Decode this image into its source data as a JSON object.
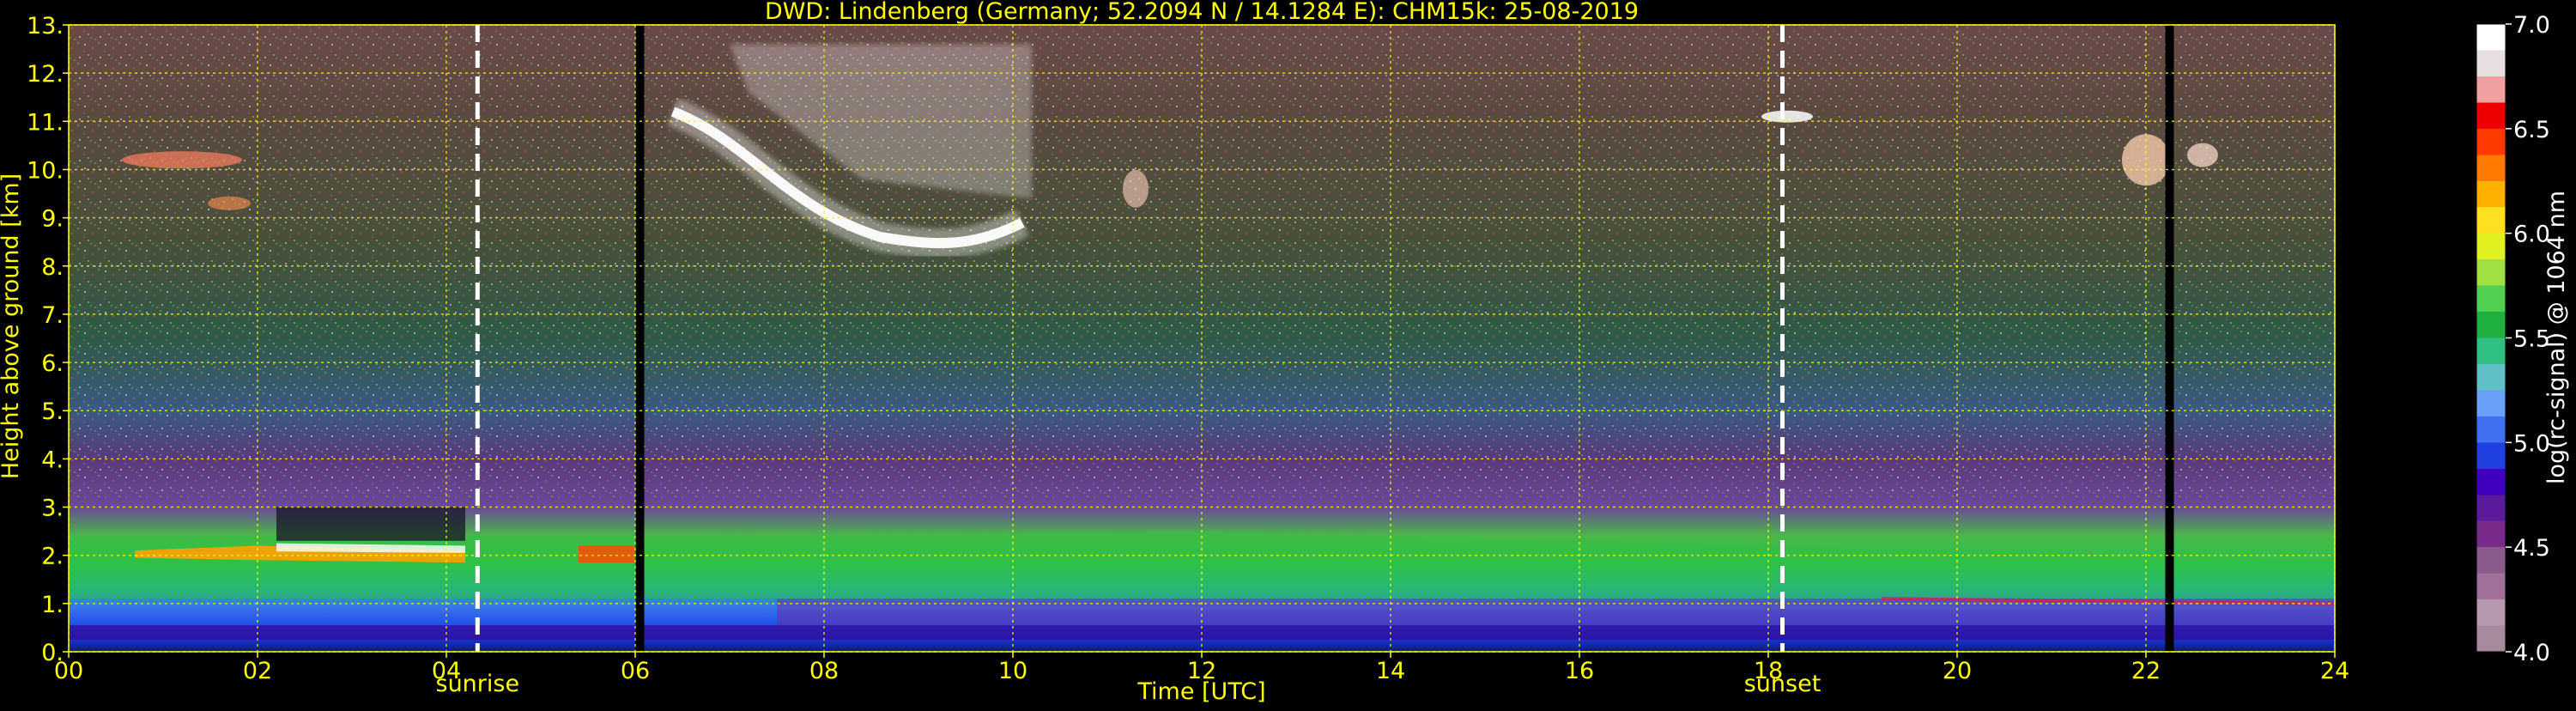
{
  "chart_data": {
    "type": "heatmap",
    "title": "DWD: Lindenberg (Germany; 52.2094 N / 14.1284 E):    CHM15k: 25-08-2019",
    "xlabel": "Time [UTC]",
    "ylabel": "Height above ground [km]",
    "xlim": [
      0,
      24
    ],
    "ylim": [
      0,
      13
    ],
    "x_ticks": [
      0,
      2,
      4,
      6,
      8,
      10,
      12,
      14,
      16,
      18,
      20,
      22,
      24
    ],
    "x_tick_labels": [
      "00",
      "02",
      "04",
      "06",
      "08",
      "10",
      "12",
      "14",
      "16",
      "18",
      "20",
      "22",
      "24"
    ],
    "y_ticks": [
      0,
      1,
      2,
      3,
      4,
      5,
      6,
      7,
      8,
      9,
      10,
      11,
      12,
      13
    ],
    "y_tick_labels": [
      "0.",
      "1.",
      "1.",
      "2.",
      "3.",
      "4.",
      "5.",
      "6.",
      "7.",
      "8.",
      "9.",
      "10.",
      "11.",
      "12.",
      "13."
    ],
    "y_tick_labels_shown": [
      "0.",
      "1.",
      "2.",
      "3.",
      "4.",
      "5.",
      "6.",
      "7.",
      "8.",
      "9.",
      "10.",
      "11.",
      "12.",
      "13."
    ],
    "grid": true,
    "grid_color": "#ffff00",
    "annotations": [
      {
        "label": "sunrise",
        "x": 4.33,
        "style": "dashed",
        "color": "#ffffff"
      },
      {
        "label": "sunset",
        "x": 18.15,
        "style": "dashed",
        "color": "#ffffff"
      }
    ],
    "data_gaps": [
      6.05,
      22.25
    ],
    "features": [
      {
        "name": "boundary-layer-aerosol",
        "x_range": [
          0,
          24
        ],
        "height_range": [
          0.2,
          2.5
        ]
      },
      {
        "name": "cirrus",
        "x_range": [
          6.4,
          10.2
        ],
        "height_range": [
          8.0,
          11.3
        ]
      },
      {
        "name": "cirrus",
        "x_range": [
          0,
          2.1
        ],
        "height_range": [
          9.2,
          10.5
        ]
      },
      {
        "name": "cirrus",
        "x_range": [
          17.7,
          18.6
        ],
        "height_range": [
          11.0,
          11.3
        ]
      },
      {
        "name": "cirrus",
        "x_range": [
          21.5,
          22.8
        ],
        "height_range": [
          9.6,
          10.8
        ]
      }
    ],
    "colorbar": {
      "label": "log(rc-signal) @ 1064 nm",
      "min": 4.0,
      "max": 7.0,
      "ticks": [
        4.0,
        4.5,
        5.0,
        5.5,
        6.0,
        6.5,
        7.0
      ],
      "tick_labels": [
        "4.0",
        "4.5",
        "5.0",
        "5.5",
        "6.0",
        "6.5",
        "7.0"
      ],
      "colors": [
        "#a68b9e",
        "#b699ae",
        "#a07098",
        "#8a5a8c",
        "#7a2a8a",
        "#5a1a9a",
        "#4000c0",
        "#2040e0",
        "#4070f0",
        "#6aa0f8",
        "#60c0c8",
        "#2fbf80",
        "#20b040",
        "#50d050",
        "#a0e040",
        "#e0f020",
        "#ffe020",
        "#ffb000",
        "#ff7a00",
        "#ff3a00",
        "#ee0000",
        "#f0a0a0",
        "#e8e0e0",
        "#ffffff"
      ]
    }
  },
  "colors": {
    "text": "#ffff00",
    "background": "#000000",
    "frame": "#ffff00"
  }
}
